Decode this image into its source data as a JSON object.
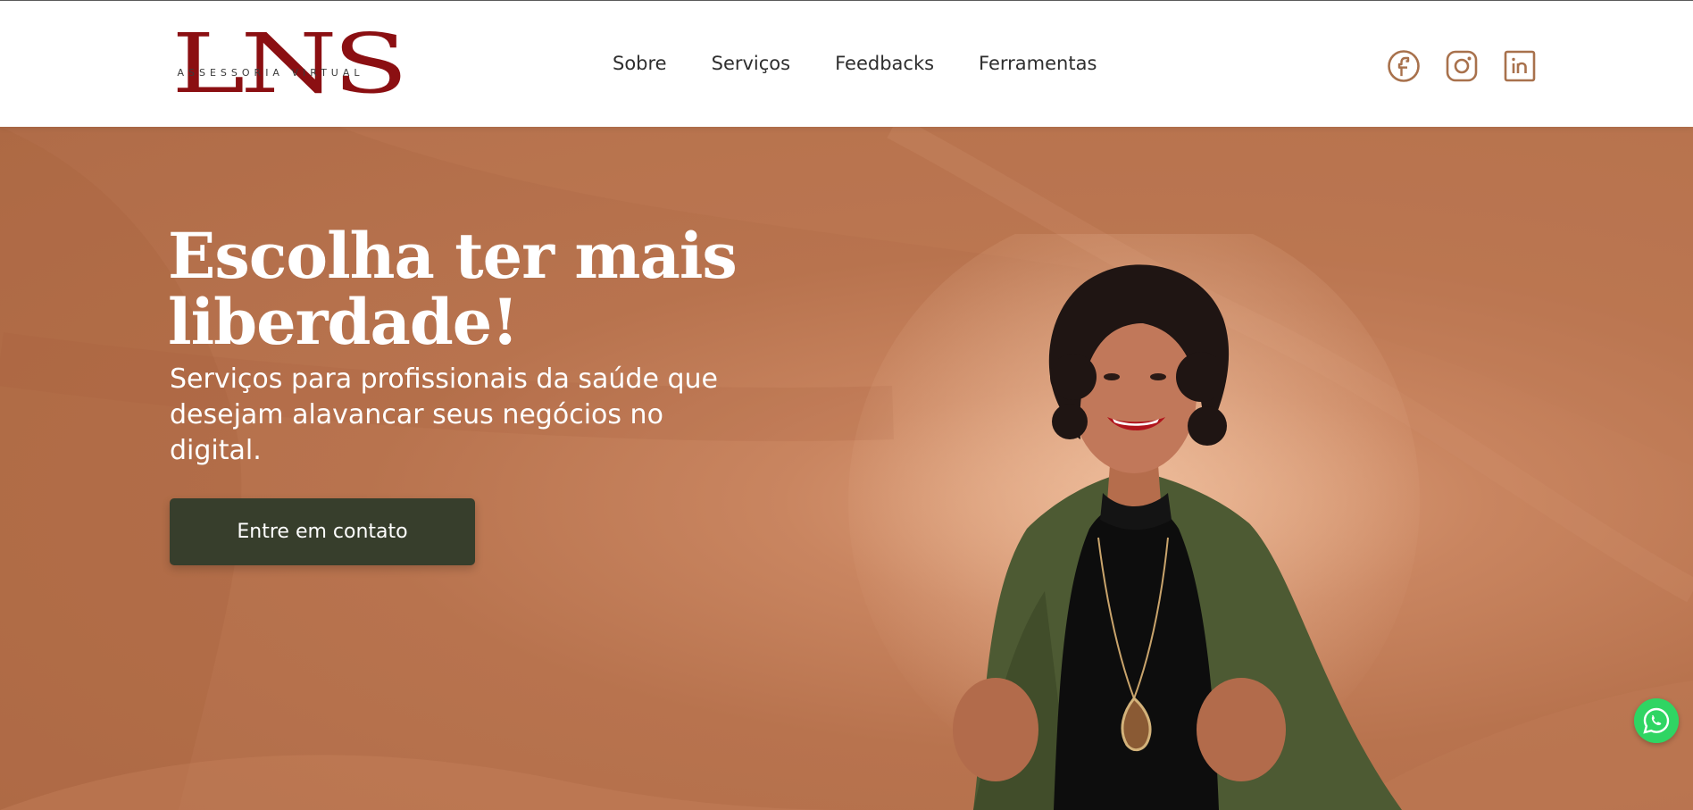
{
  "brand": {
    "logo_letters": "LNS",
    "logo_subtitle": "ASSESSORIA VIRTUAL",
    "logo_color": "#8b0f12"
  },
  "nav": {
    "items": [
      {
        "label": "Sobre"
      },
      {
        "label": "Serviços"
      },
      {
        "label": "Feedbacks"
      },
      {
        "label": "Ferramentas"
      }
    ]
  },
  "social": {
    "icons": [
      "facebook-icon",
      "instagram-icon",
      "linkedin-icon"
    ],
    "color": "#a8714c"
  },
  "hero": {
    "title": "Escolha ter mais liberdade!",
    "subtitle": "Serviços para profissionais da saúde que desejam alavancar seus negócios no digital.",
    "cta_label": "Entre em contato",
    "background_color": "#b8734e",
    "cta_color": "#373e2c"
  },
  "whatsapp": {
    "icon": "whatsapp-icon",
    "color": "#2fd563"
  }
}
